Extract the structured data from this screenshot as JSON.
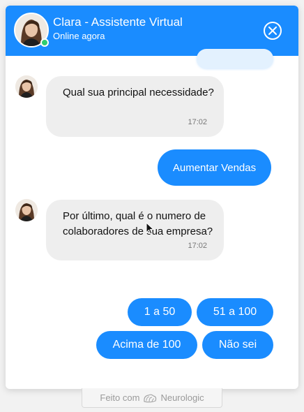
{
  "header": {
    "title": "Clara - Assistente Virtual",
    "status": "Online agora"
  },
  "messages": [
    {
      "text": "Qual sua principal necessidade?",
      "time": "17:02"
    },
    {
      "text": "Aumentar Vendas"
    },
    {
      "text": "Por último, qual é o numero de colaboradores de sua empresa?",
      "time": "17:02"
    }
  ],
  "options": [
    "1 a 50",
    "51 a 100",
    "Acima de 100",
    "Não sei"
  ],
  "footer": {
    "prefix": "Feito com",
    "brand": "Neurologic"
  },
  "colors": {
    "accent": "#1a8cff",
    "bot_bubble": "#eeeeee",
    "online": "#2ecc71"
  },
  "icons": [
    "close-icon",
    "online-status-icon",
    "neurologic-logo-icon",
    "mouse-cursor-icon"
  ]
}
